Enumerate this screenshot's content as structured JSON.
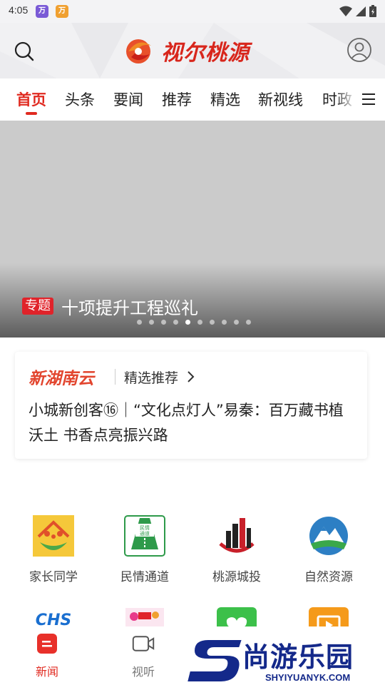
{
  "status_bar": {
    "time": "4:05",
    "app_icons": [
      "万",
      "万"
    ]
  },
  "header": {
    "logo_text": "视尔桃源",
    "search_icon": "search-icon",
    "user_icon": "user-icon"
  },
  "tabs": [
    {
      "label": "首页",
      "active": true
    },
    {
      "label": "头条"
    },
    {
      "label": "要闻"
    },
    {
      "label": "推荐"
    },
    {
      "label": "精选"
    },
    {
      "label": "新视线"
    },
    {
      "label": "时政"
    }
  ],
  "banner": {
    "tag": "专题",
    "title": "十项提升工程巡礼",
    "slide_count": 10,
    "active_slide": 5
  },
  "recommend_card": {
    "brand": "新湖南云",
    "section": "精选推荐",
    "headline": "小城新创客⑯｜“文化点灯人”易秦：百万藏书植沃土 书香点亮振兴路"
  },
  "services": [
    {
      "label": "家长同学",
      "icon": "family-icon"
    },
    {
      "label": "民情通道",
      "icon": "road-icon"
    },
    {
      "label": "桃源城投",
      "icon": "buildings-icon"
    },
    {
      "label": "自然资源",
      "icon": "mountain-icon"
    }
  ],
  "services_row2": [
    "chs-icon",
    "festival-icon",
    "heart-icon",
    "video-icon"
  ],
  "bottom_nav": [
    {
      "label": "新闻",
      "active": true,
      "icon": "news-icon"
    },
    {
      "label": "视听",
      "icon": "video-camera-icon"
    }
  ],
  "watermark": {
    "title": "尚游乐园",
    "url": "SHYIYUANYK.COM"
  },
  "colors": {
    "accent": "#e02a20",
    "banner_gray": "#cbcbcb",
    "watermark_blue": "#14298a"
  }
}
